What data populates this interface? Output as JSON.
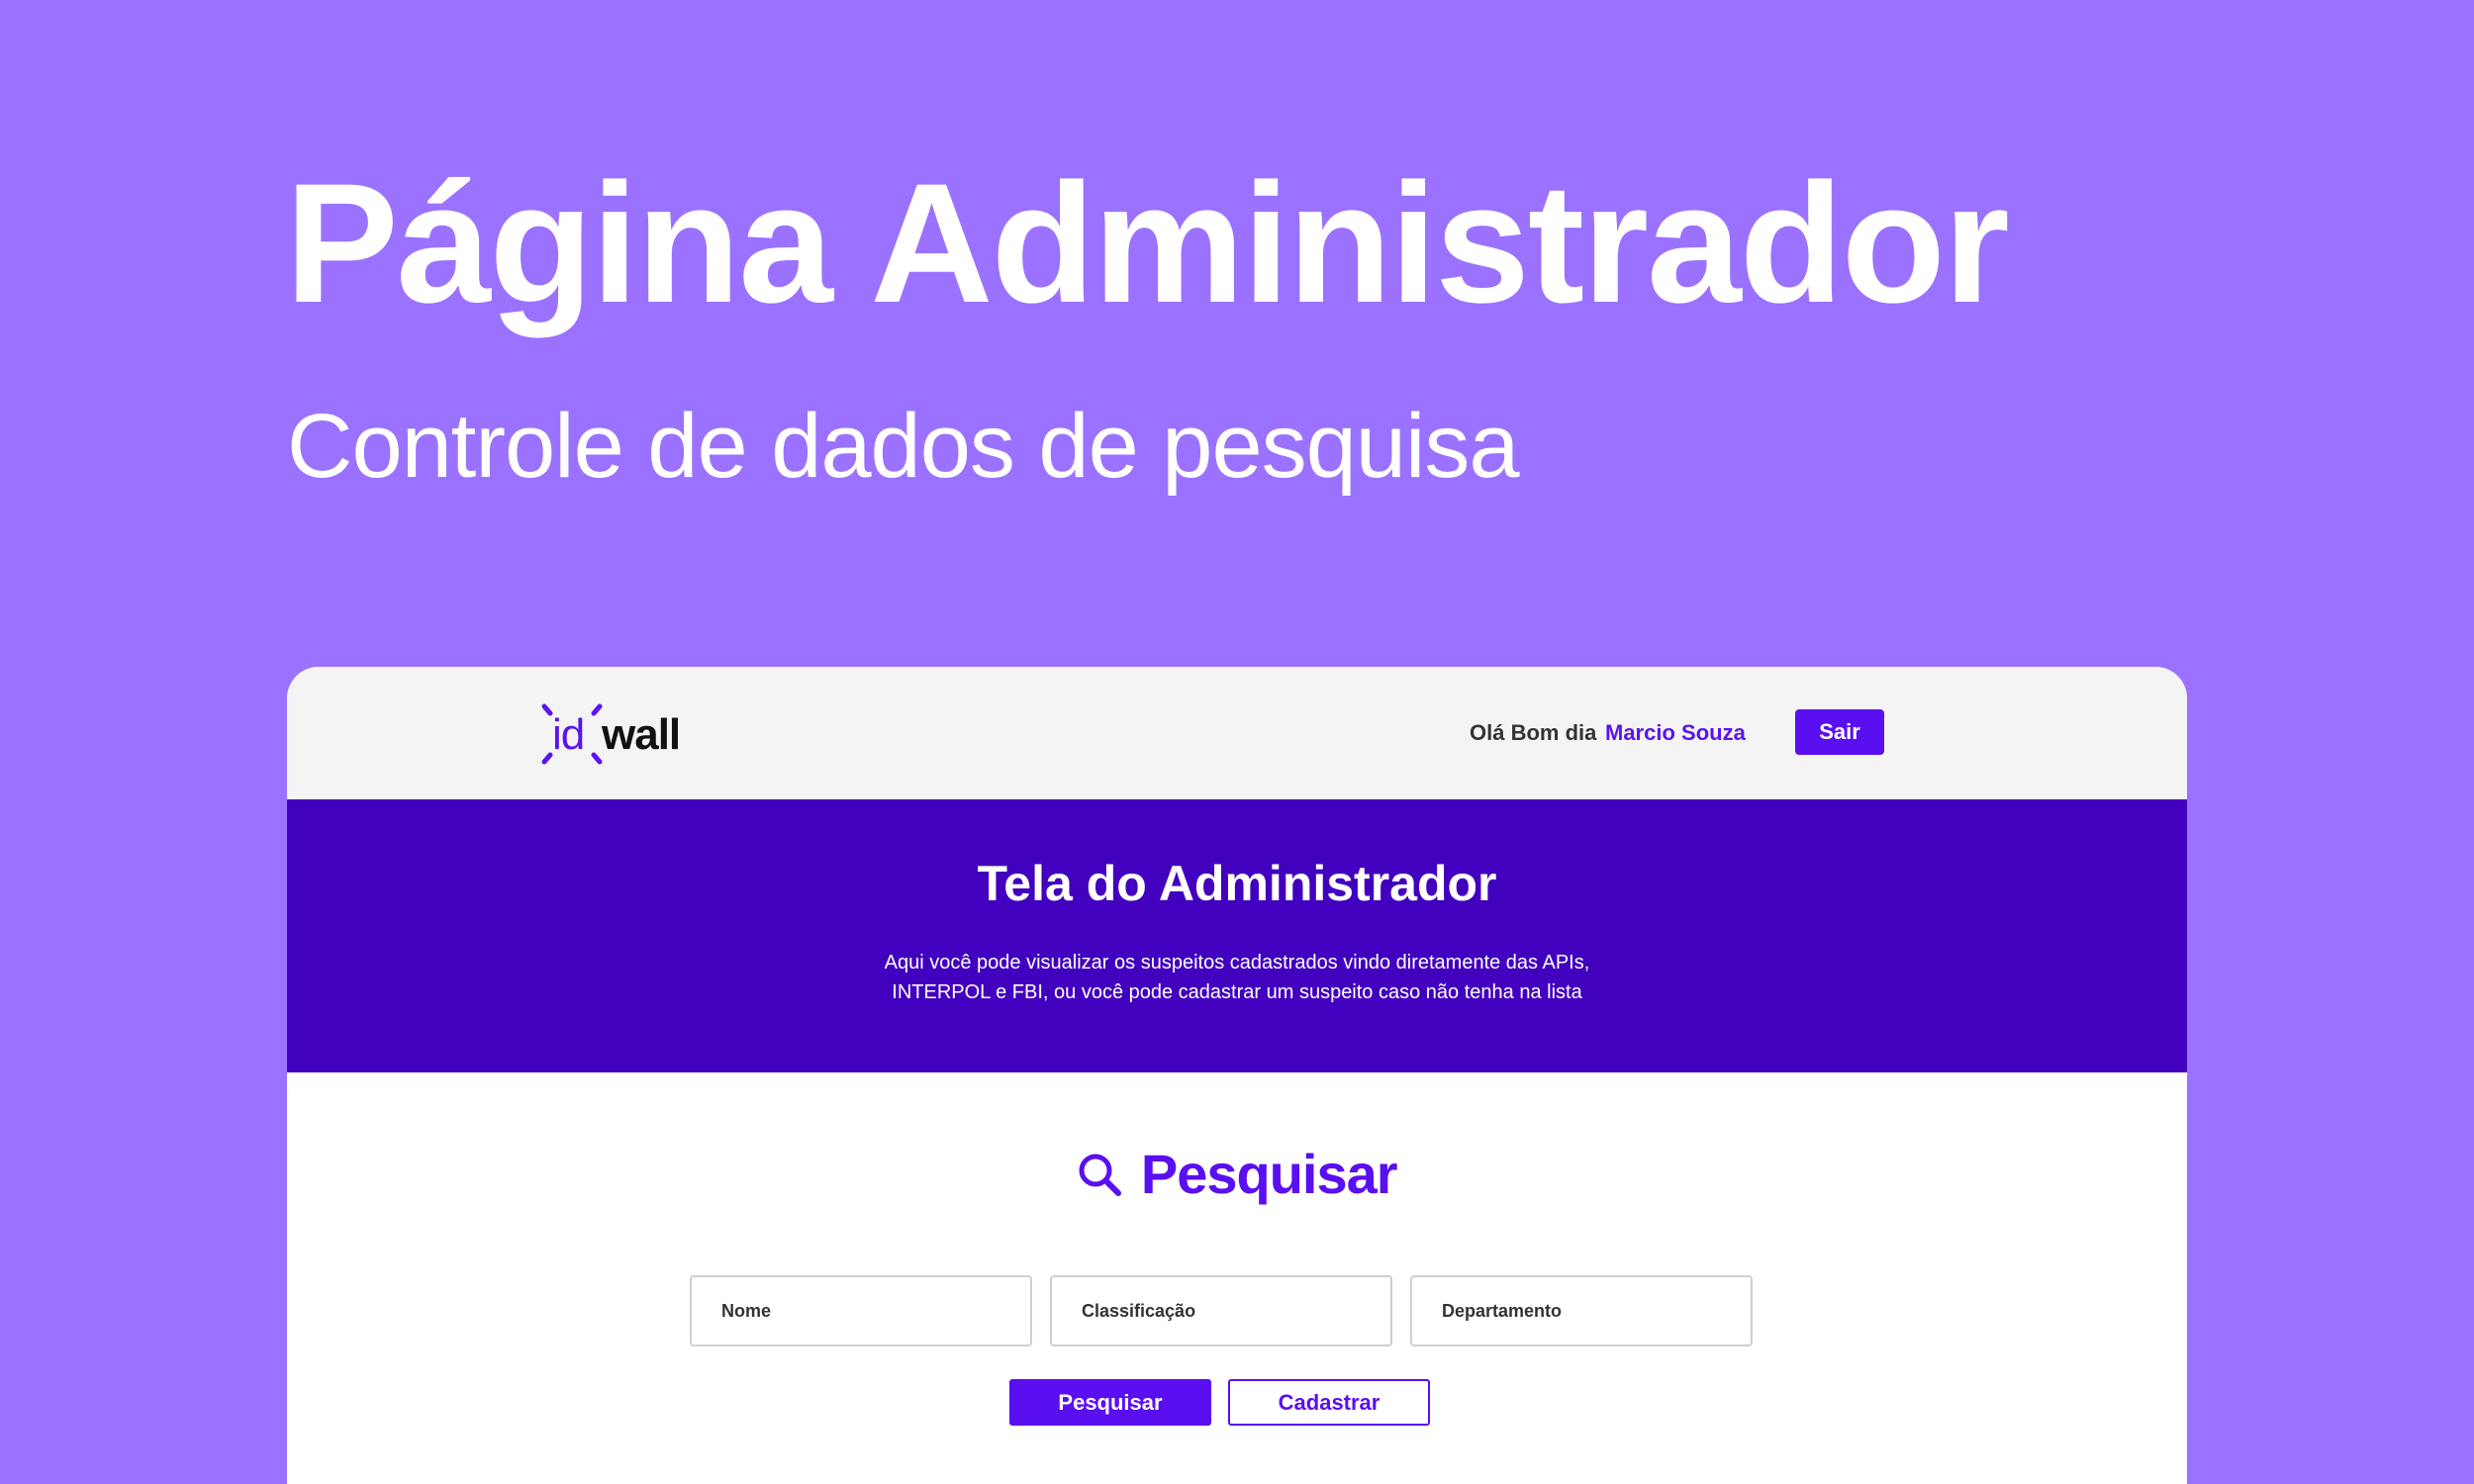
{
  "hero": {
    "title": "Página Administrador",
    "subtitle": "Controle de dados de pesquisa"
  },
  "header": {
    "logo": {
      "part1": "id",
      "part2": "wall"
    },
    "greeting": "Olá Bom dia",
    "user_name": "Marcio Souza",
    "logout_label": "Sair"
  },
  "banner": {
    "title": "Tela do Administrador",
    "description": "Aqui você pode visualizar os suspeitos cadastrados vindo diretamente das APIs, INTERPOL e FBI, ou você pode cadastrar um suspeito caso não tenha na lista"
  },
  "search": {
    "icon": "search-icon",
    "title": "Pesquisar",
    "fields": {
      "name_placeholder": "Nome",
      "classification_placeholder": "Classificação",
      "department_placeholder": "Departamento"
    },
    "search_button": "Pesquisar",
    "register_button": "Cadastrar"
  },
  "colors": {
    "background": "#9b72ff",
    "brand": "#5a0ff0",
    "banner": "#4200bf",
    "header": "#f4f4f4"
  }
}
